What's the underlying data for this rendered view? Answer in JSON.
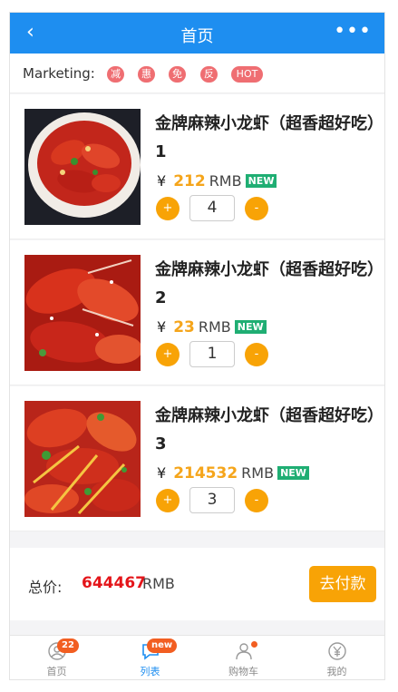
{
  "header": {
    "back_icon": "chevron-left-icon",
    "title": "首页",
    "more_icon": "more-dots-icon"
  },
  "marketing": {
    "label": "Marketing:",
    "tags": [
      "减",
      "惠",
      "免",
      "反",
      "HOT"
    ]
  },
  "currency_symbol": "¥",
  "products": [
    {
      "name": "金牌麻辣小龙虾（超香超好吃）1",
      "price": "212",
      "unit": "RMB",
      "badge": "NEW",
      "quantity": "4",
      "plus": "+",
      "minus": "-"
    },
    {
      "name": "金牌麻辣小龙虾（超香超好吃）2",
      "price": "23",
      "unit": "RMB",
      "badge": "NEW",
      "quantity": "1",
      "plus": "+",
      "minus": "-"
    },
    {
      "name": "金牌麻辣小龙虾（超香超好吃）3",
      "price": "214532",
      "unit": "RMB",
      "badge": "NEW",
      "quantity": "3",
      "plus": "+",
      "minus": "-"
    }
  ],
  "total": {
    "label": "总价:",
    "value": "644467",
    "unit": "RMB",
    "pay_button": "去付款"
  },
  "tabbar": [
    {
      "label": "首页",
      "icon": "home-icon",
      "badge": "22"
    },
    {
      "label": "列表",
      "icon": "chat-icon",
      "badge": "new"
    },
    {
      "label": "购物车",
      "icon": "cart-icon",
      "dot": true
    },
    {
      "label": "我的",
      "icon": "yen-icon"
    }
  ],
  "colors": {
    "primary": "#1e8ef0",
    "accent": "#f8a306",
    "price": "#f5a51b",
    "total": "#e4151a",
    "new_badge": "#1fae73",
    "tag": "#ef6e72"
  }
}
